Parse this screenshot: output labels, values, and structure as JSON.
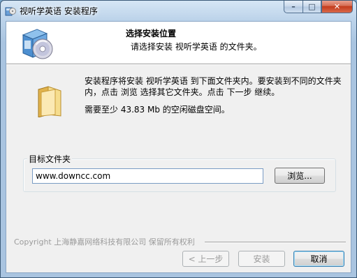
{
  "window": {
    "title": "视听学英语 安装程序",
    "controls": {
      "minimize": "–",
      "maximize": "□",
      "close": "✕"
    }
  },
  "header": {
    "title": "选择安装位置",
    "subtitle": "请选择安装 视听学英语 的文件夹。"
  },
  "body": {
    "description": "安装程序将安装 视听学英语 到下面文件夹内。要安装到不同的文件夹内，点击 浏览 选择其它文件夹。点击 下一步 继续。",
    "space_required": "需要至少 43.83 Mb 的空闲磁盘空间。"
  },
  "destination": {
    "group_label": "目标文件夹",
    "path_value": "www.downcc.com",
    "browse_label": "浏览..."
  },
  "footer": {
    "copyright": "Copyright 上海静嘉网络科技有限公司 保留所有权利",
    "back_label": "< 上一步",
    "install_label": "安装",
    "cancel_label": "取消"
  },
  "icons": {
    "title": "setup-icon",
    "header": "install-box-cd-icon",
    "folder": "folder-icon"
  }
}
